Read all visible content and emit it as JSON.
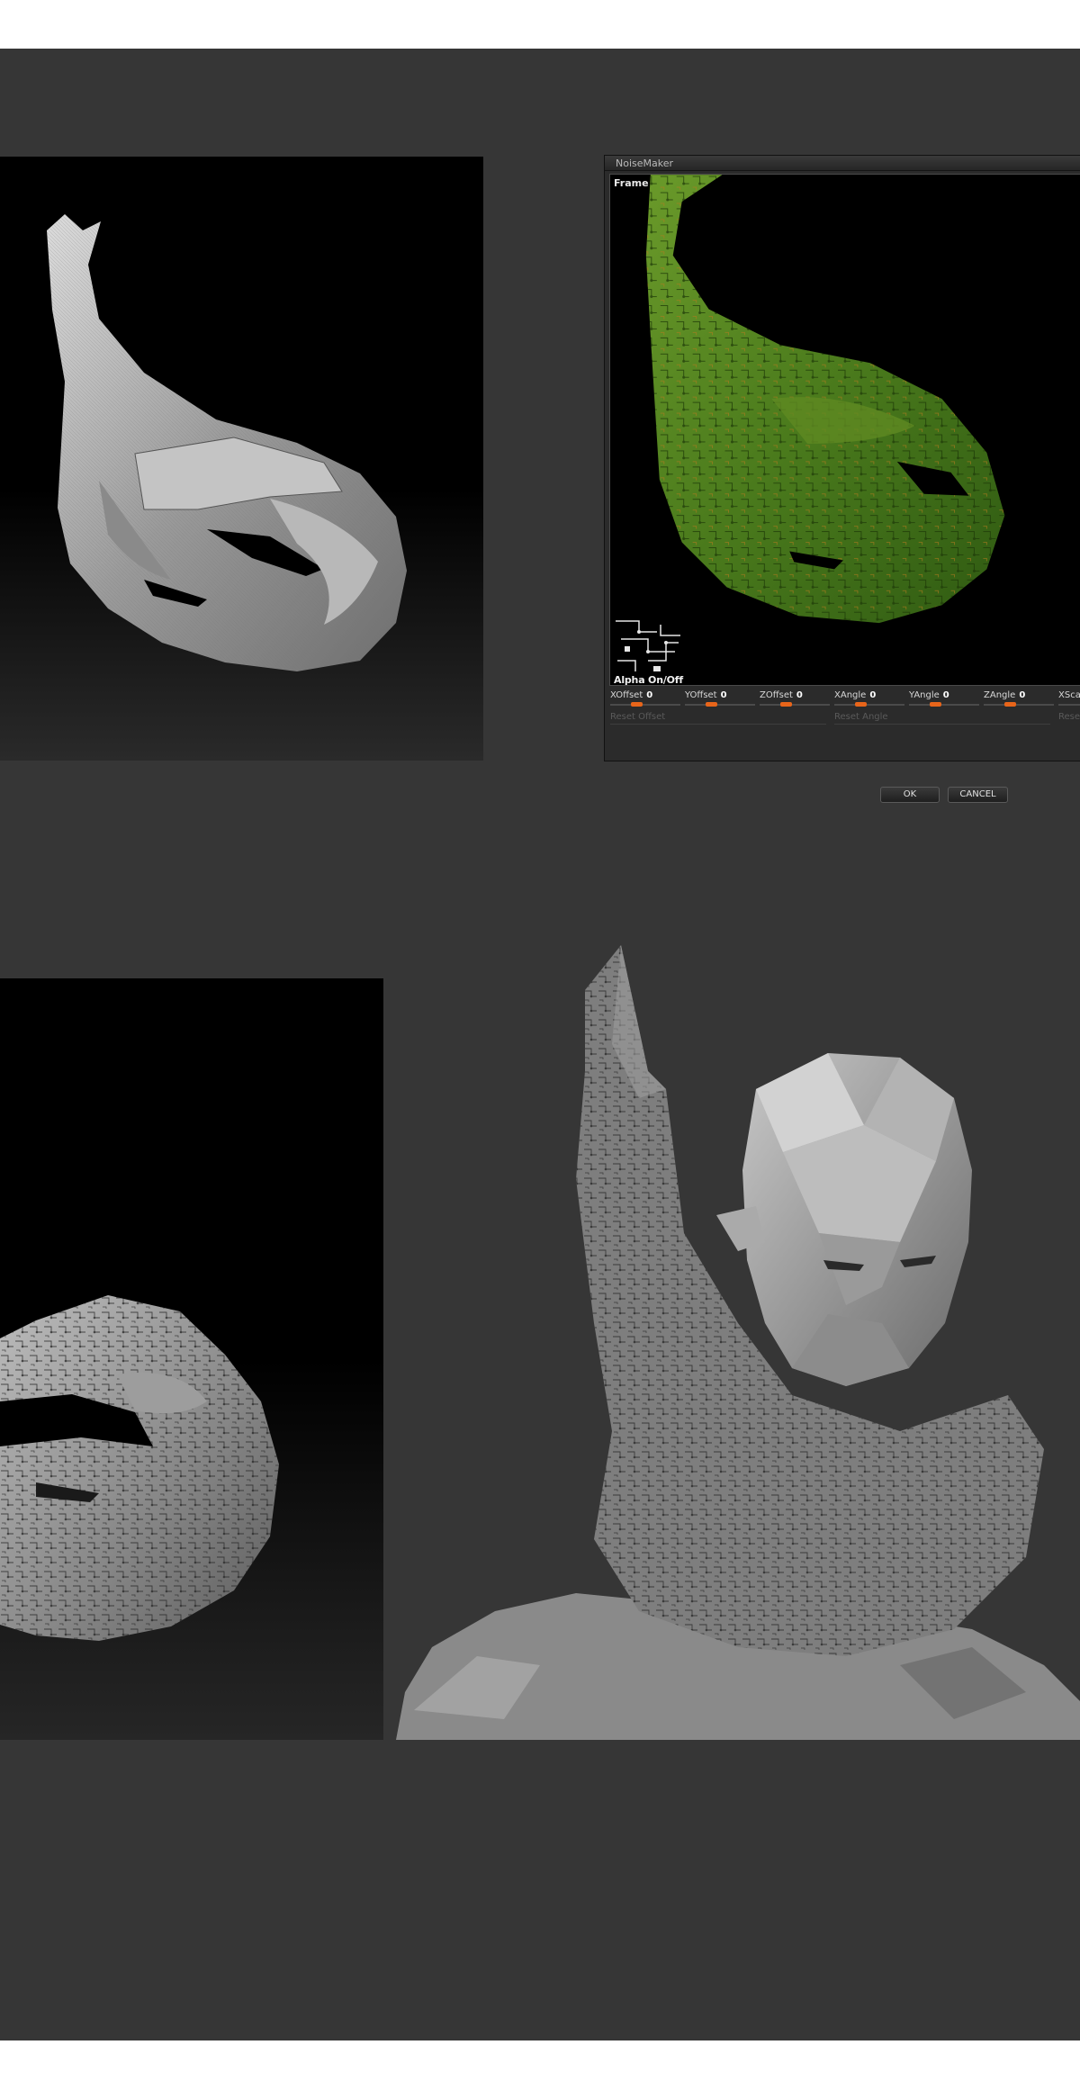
{
  "noisemaker": {
    "title": "NoiseMaker",
    "viewport_label": "Frame",
    "alpha_toggle": "Alpha On/Off",
    "sliders": [
      {
        "label": "XOffset",
        "value": "0",
        "knob_fraction": 0.35
      },
      {
        "label": "YOffset",
        "value": "0",
        "knob_fraction": 0.35
      },
      {
        "label": "ZOffset",
        "value": "0",
        "knob_fraction": 0.35
      },
      {
        "label": "XAngle",
        "value": "0",
        "knob_fraction": 0.35
      },
      {
        "label": "YAngle",
        "value": "0",
        "knob_fraction": 0.35
      },
      {
        "label": "ZAngle",
        "value": "0",
        "knob_fraction": 0.35
      },
      {
        "label": "XSca",
        "value": "",
        "knob_fraction": 0.35
      }
    ],
    "reset_offset": "Reset Offset",
    "reset_angle": "Reset Angle",
    "reset_scale": "Rese",
    "ok_label": "OK",
    "cancel_label": "CANCEL"
  },
  "colors": {
    "stage_background": "#363636",
    "slider_knob": "#e8651a",
    "pattern_green": "#4a7a1c"
  }
}
